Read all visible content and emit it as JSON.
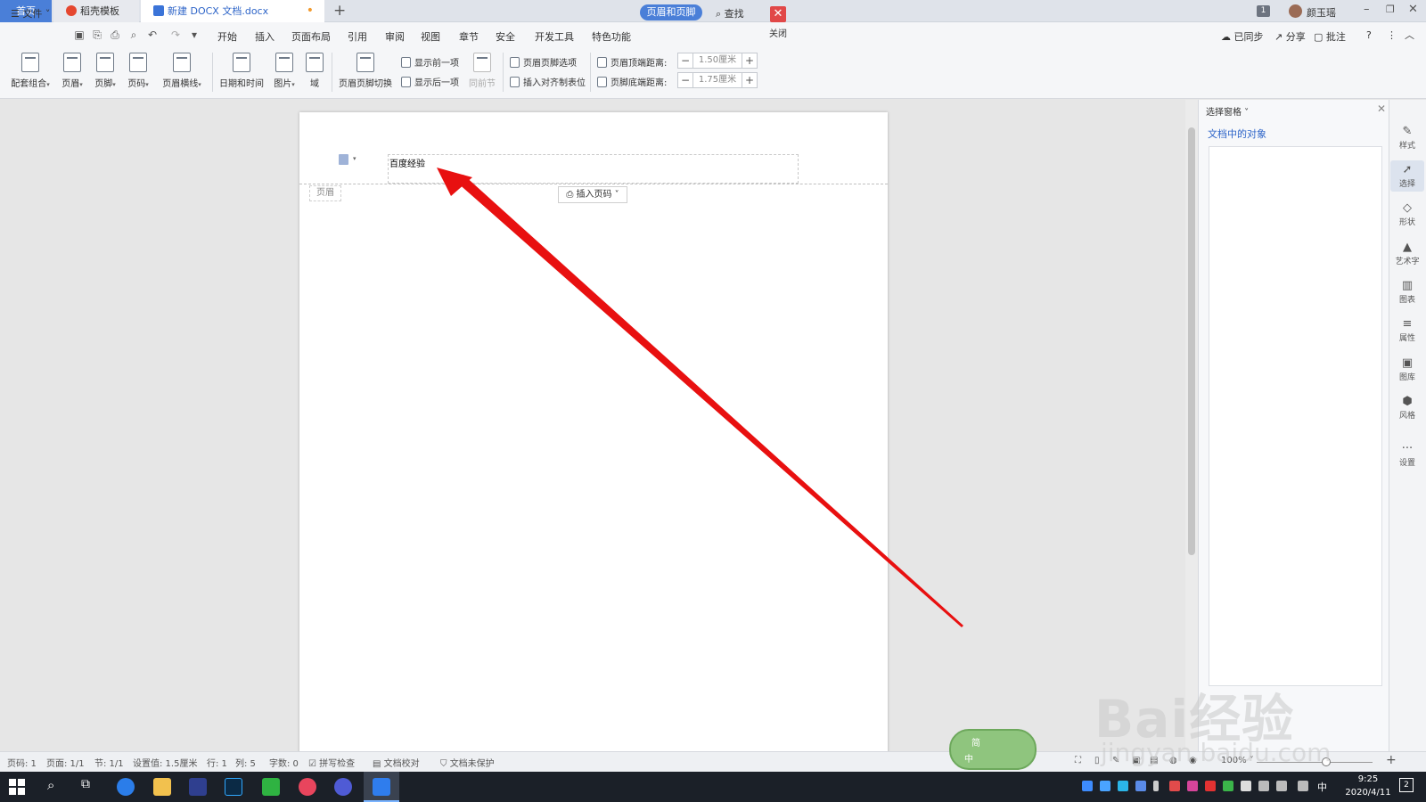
{
  "tabs": {
    "home": "首页",
    "templates": "稻壳模板",
    "document": "新建 DOCX 文档.docx",
    "doc_modified_dot": "•",
    "add": "+"
  },
  "titlebar": {
    "badge": "1",
    "user_name": "颜玉瑶",
    "minimize": "–",
    "maximize": "❐",
    "close": "✕"
  },
  "menu": {
    "file": "☰ 文件 ˅",
    "tabs": [
      "开始",
      "插入",
      "页面布局",
      "引用",
      "审阅",
      "视图",
      "章节",
      "安全",
      "开发工具",
      "特色功能"
    ],
    "active_tab": "页眉和页脚",
    "search": "查找",
    "sync": "已同步",
    "share": "分享",
    "comment": "批注",
    "help": "?"
  },
  "ribbon": {
    "combo": "配套组合",
    "header": "页眉",
    "footer": "页脚",
    "page_number": "页码",
    "header_line": "页眉横线",
    "datetime": "日期和时间",
    "picture": "图片",
    "field": "域",
    "switch": "页眉页脚切换",
    "show_prev": "显示前一项",
    "show_next": "显示后一项",
    "same_as_prev": "同前节",
    "hf_options": "页眉页脚选项",
    "insert_align_tab": "插入对齐制表位",
    "header_top_label": "页眉顶端距离:",
    "header_top_value": "1.50厘米",
    "footer_bottom_label": "页脚底端距离:",
    "footer_bottom_value": "1.75厘米",
    "close": "关闭"
  },
  "document": {
    "header_text": "百度经验",
    "header_label": "页眉",
    "insert_page_number": "插入页码 ˅"
  },
  "selection_pane": {
    "title": "选择窗格 ˅",
    "objects_title": "文档中的对象"
  },
  "right_sidebar": [
    "样式",
    "选择",
    "形状",
    "艺术字",
    "图表",
    "属性",
    "图库",
    "风格",
    "设置"
  ],
  "status": {
    "page": "页码: 1",
    "pages": "页面: 1/1",
    "section": "节: 1/1",
    "setting": "设置值: 1.5厘米",
    "row": "行: 1",
    "col": "列: 5",
    "words": "字数: 0",
    "spellcheck": "拼写检查",
    "proofread": "文档校对",
    "protect": "文档未保护",
    "zoom": "100% ˅"
  },
  "ime": {
    "mode": "简",
    "lang": "中"
  },
  "taskbar": {
    "ime_lang": "中",
    "time": "9:25",
    "date": "2020/4/11",
    "notifications": "2"
  },
  "watermark": {
    "brand": "Bai经验",
    "url": "jingyan.baidu.com"
  },
  "colors": {
    "accent": "#4a7fd8",
    "arrow": "#e81010",
    "close_red": "#e14848",
    "link_blue": "#2d64c8"
  }
}
